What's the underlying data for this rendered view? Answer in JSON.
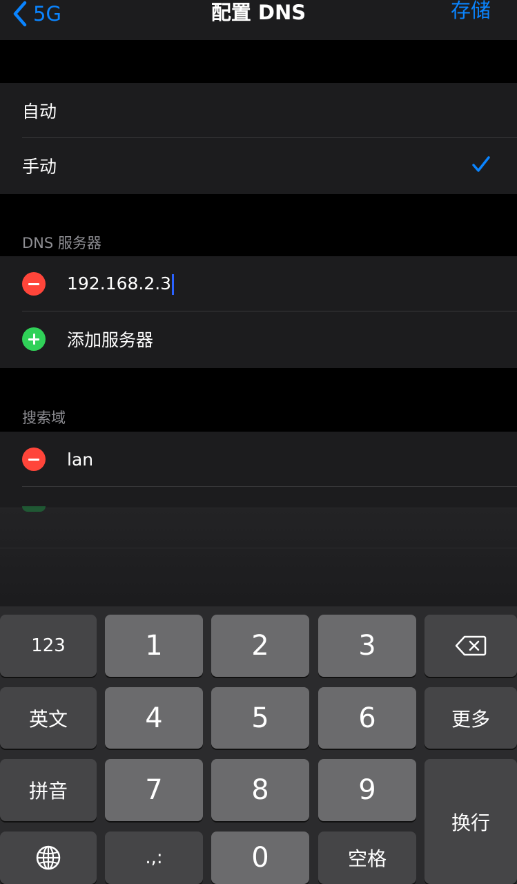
{
  "nav": {
    "back_label": "5G",
    "title": "配置 DNS",
    "save_label": "存储"
  },
  "mode": {
    "options": [
      {
        "label": "自动",
        "selected": false
      },
      {
        "label": "手动",
        "selected": true
      }
    ]
  },
  "dns": {
    "header": "DNS 服务器",
    "servers": [
      "192.168.2.3"
    ],
    "add_label": "添加服务器"
  },
  "search_domains": {
    "header": "搜索域",
    "domains": [
      "lan"
    ]
  },
  "keyboard": {
    "keys": {
      "k123": "123",
      "k1": "1",
      "k2": "2",
      "k3": "3",
      "english": "英文",
      "k4": "4",
      "k5": "5",
      "k6": "6",
      "more": "更多",
      "pinyin": "拼音",
      "k7": "7",
      "k8": "8",
      "k9": "9",
      "return": "换行",
      "punct": ".,:",
      "k0": "0",
      "space": "空格"
    },
    "icons": {
      "delete": "delete-icon",
      "globe": "globe-icon"
    }
  },
  "colors": {
    "accent": "#0a84ff",
    "remove": "#ff453a",
    "add": "#30d158",
    "cell_bg": "#1c1c1e"
  }
}
